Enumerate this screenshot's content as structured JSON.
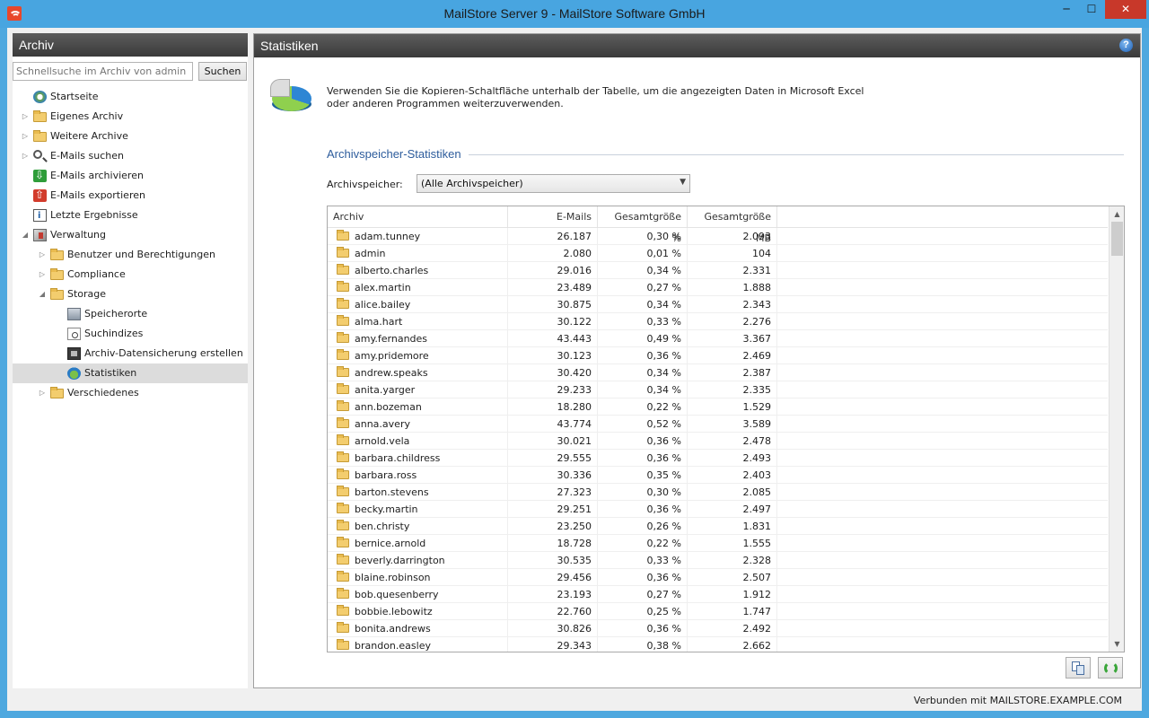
{
  "window": {
    "title": "MailStore Server 9 - MailStore Software GmbH",
    "min_label": "─",
    "max_label": "☐",
    "close_label": "✕"
  },
  "left_panel": {
    "title": "Archiv",
    "search_placeholder": "Schnellsuche im Archiv von admin",
    "search_button": "Suchen",
    "tree": [
      {
        "label": "Startseite",
        "icon": "home-icon"
      },
      {
        "label": "Eigenes Archiv",
        "icon": "folder-icon"
      },
      {
        "label": "Weitere Archive",
        "icon": "folder-icon"
      },
      {
        "label": "E-Mails suchen",
        "icon": "search-icon"
      },
      {
        "label": "E-Mails archivieren",
        "icon": "archive-icon"
      },
      {
        "label": "E-Mails exportieren",
        "icon": "export-icon"
      },
      {
        "label": "Letzte Ergebnisse",
        "icon": "info-icon"
      },
      {
        "label": "Verwaltung",
        "icon": "admin-icon"
      },
      {
        "label": "Benutzer und Berechtigungen",
        "icon": "folder-icon"
      },
      {
        "label": "Compliance",
        "icon": "folder-icon"
      },
      {
        "label": "Storage",
        "icon": "folder-icon"
      },
      {
        "label": "Speicherorte",
        "icon": "storage-icon"
      },
      {
        "label": "Suchindizes",
        "icon": "index-icon"
      },
      {
        "label": "Archiv-Datensicherung erstellen",
        "icon": "backup-icon"
      },
      {
        "label": "Statistiken",
        "icon": "stats-icon"
      },
      {
        "label": "Verschiedenes",
        "icon": "folder-icon"
      }
    ]
  },
  "right_panel": {
    "title": "Statistiken",
    "hint": "Verwenden Sie die Kopieren-Schaltfläche unterhalb der Tabelle, um die angezeigten Daten in Microsoft Excel oder anderen Programmen weiterzuverwenden.",
    "section_title": "Archivspeicher-Statistiken",
    "select_label": "Archivspeicher:",
    "select_value": "(Alle Archivspeicher)",
    "columns": [
      "Archiv",
      "E-Mails",
      "Gesamtgröße %",
      "Gesamtgröße MB"
    ],
    "rows": [
      [
        "adam.tunney",
        "26.187",
        "0,30 %",
        "2.093"
      ],
      [
        "admin",
        "2.080",
        "0,01 %",
        "104"
      ],
      [
        "alberto.charles",
        "29.016",
        "0,34 %",
        "2.331"
      ],
      [
        "alex.martin",
        "23.489",
        "0,27 %",
        "1.888"
      ],
      [
        "alice.bailey",
        "30.875",
        "0,34 %",
        "2.343"
      ],
      [
        "alma.hart",
        "30.122",
        "0,33 %",
        "2.276"
      ],
      [
        "amy.fernandes",
        "43.443",
        "0,49 %",
        "3.367"
      ],
      [
        "amy.pridemore",
        "30.123",
        "0,36 %",
        "2.469"
      ],
      [
        "andrew.speaks",
        "30.420",
        "0,34 %",
        "2.387"
      ],
      [
        "anita.yarger",
        "29.233",
        "0,34 %",
        "2.335"
      ],
      [
        "ann.bozeman",
        "18.280",
        "0,22 %",
        "1.529"
      ],
      [
        "anna.avery",
        "43.774",
        "0,52 %",
        "3.589"
      ],
      [
        "arnold.vela",
        "30.021",
        "0,36 %",
        "2.478"
      ],
      [
        "barbara.childress",
        "29.555",
        "0,36 %",
        "2.493"
      ],
      [
        "barbara.ross",
        "30.336",
        "0,35 %",
        "2.403"
      ],
      [
        "barton.stevens",
        "27.323",
        "0,30 %",
        "2.085"
      ],
      [
        "becky.martin",
        "29.251",
        "0,36 %",
        "2.497"
      ],
      [
        "ben.christy",
        "23.250",
        "0,26 %",
        "1.831"
      ],
      [
        "bernice.arnold",
        "18.728",
        "0,22 %",
        "1.555"
      ],
      [
        "beverly.darrington",
        "30.535",
        "0,33 %",
        "2.328"
      ],
      [
        "blaine.robinson",
        "29.456",
        "0,36 %",
        "2.507"
      ],
      [
        "bob.quesenberry",
        "23.193",
        "0,27 %",
        "1.912"
      ],
      [
        "bobbie.lebowitz",
        "22.760",
        "0,25 %",
        "1.747"
      ],
      [
        "bonita.andrews",
        "30.826",
        "0,36 %",
        "2.492"
      ],
      [
        "brandon.easley",
        "29.343",
        "0,38 %",
        "2.662"
      ]
    ]
  },
  "status": {
    "text": "Verbunden mit MAILSTORE.EXAMPLE.COM"
  }
}
